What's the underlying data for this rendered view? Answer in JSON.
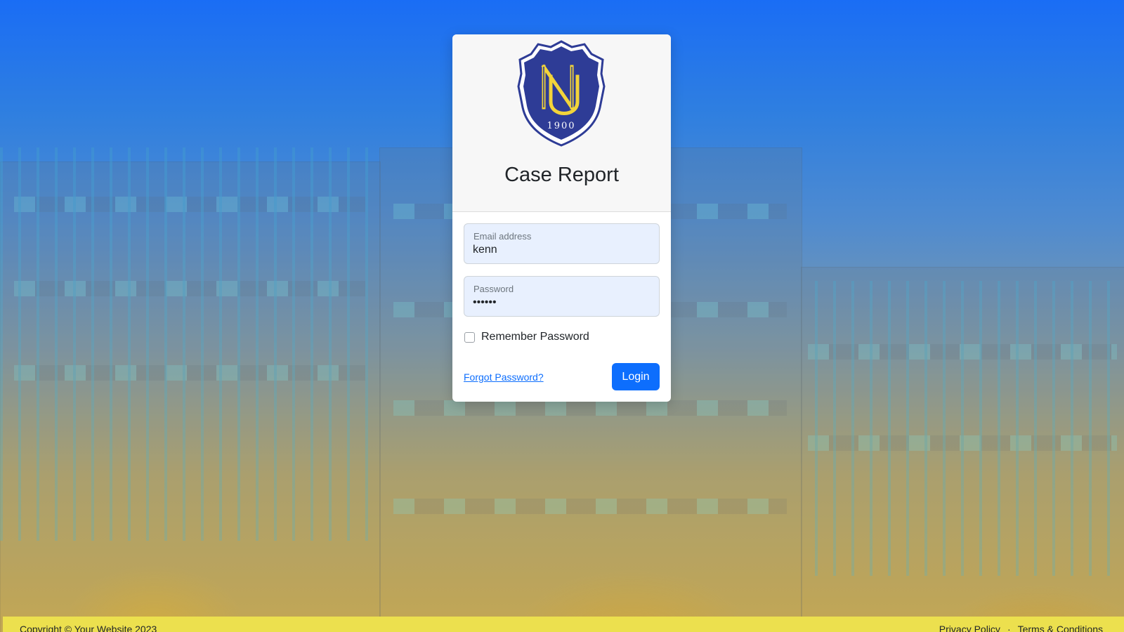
{
  "header": {
    "title": "Case Report",
    "logo_year": "1900",
    "logo_letters": "NU"
  },
  "form": {
    "email_label": "Email address",
    "email_value": "kenn",
    "password_label": "Password",
    "password_value": "••••••",
    "remember_label": "Remember Password",
    "remember_checked": false,
    "forgot_label": "Forgot Password?",
    "login_label": "Login"
  },
  "footer": {
    "copyright": "Copyright © Your Website 2023",
    "privacy_label": "Privacy Policy",
    "separator": "·",
    "terms_label": "Terms & Conditions"
  },
  "colors": {
    "primary": "#0d6efd",
    "field_bg": "#e8f0fe",
    "footer_bg": "#ece04e",
    "logo_navy": "#2e3c96",
    "logo_gold": "#f2d43a"
  }
}
